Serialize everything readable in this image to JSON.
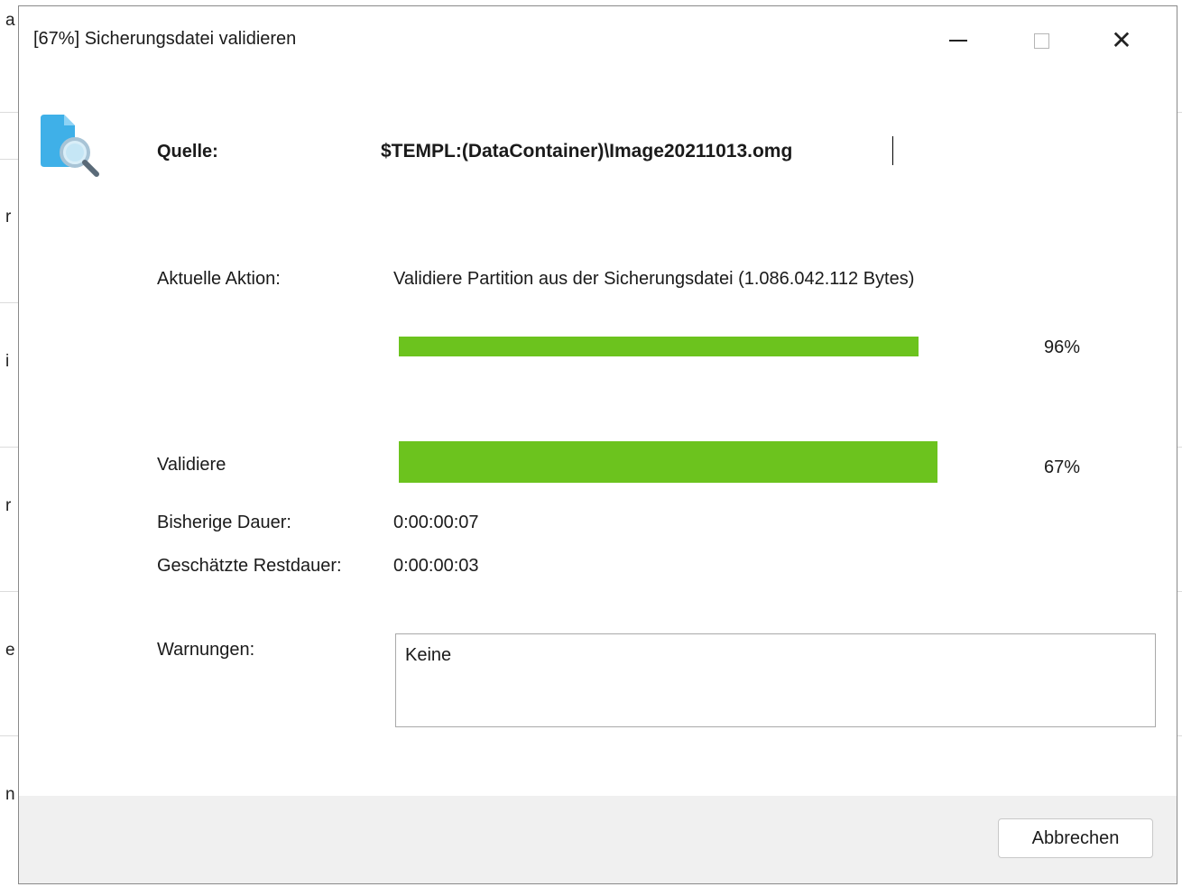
{
  "window": {
    "title": "[67%] Sicherungsdatei validieren",
    "buttons": {
      "minimize": "minimize-icon",
      "maximize": "maximize-icon",
      "close": "close-icon"
    }
  },
  "background_fragments": [
    "a",
    "r",
    "i",
    "r",
    "e",
    "n"
  ],
  "source": {
    "label": "Quelle:",
    "value": "$TEMPL:(DataContainer)\\Image20211013.omg",
    "icon": "document-search-icon"
  },
  "current_action": {
    "label": "Aktuelle Aktion:",
    "value": "Validiere Partition aus der Sicherungsdatei (1.086.042.112 Bytes)",
    "progress": 96,
    "progress_text": "96%"
  },
  "overall": {
    "label": "Validiere",
    "progress": 67,
    "progress_text": "67%"
  },
  "elapsed": {
    "label": "Bisherige Dauer:",
    "value": "0:00:00:07"
  },
  "remaining": {
    "label": "Geschätzte Restdauer:",
    "value": "0:00:00:03"
  },
  "warnings": {
    "label": "Warnungen:",
    "value": "Keine"
  },
  "footer": {
    "cancel_label": "Abbrechen"
  },
  "colors": {
    "progress_fill": "#6cc31e",
    "footer_bg": "#f0f0f0"
  }
}
